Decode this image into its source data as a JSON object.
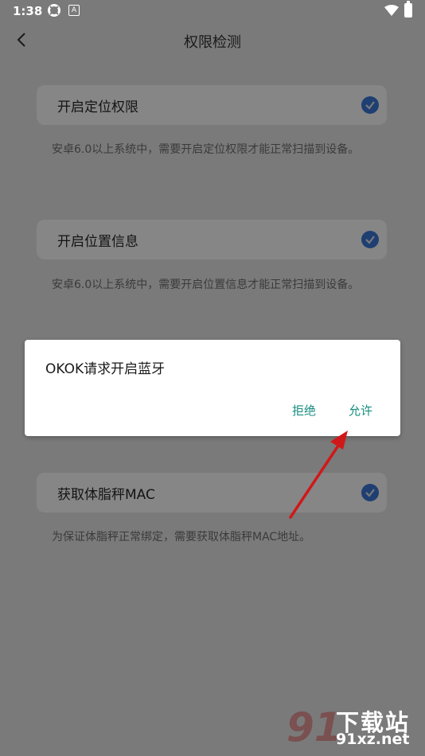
{
  "status_bar": {
    "time": "1:38",
    "icons": [
      "sync-icon",
      "a-notification-icon",
      "wifi-icon",
      "battery-icon"
    ]
  },
  "app_bar": {
    "title": "权限检测"
  },
  "permissions": [
    {
      "label": "开启定位权限",
      "desc": "安卓6.0以上系统中，需要开启定位权限才能正常扫描到设备。",
      "checked": true
    },
    {
      "label": "开启位置信息",
      "desc": "安卓6.0以上系统中，需要开启位置信息才能正常扫描到设备。",
      "checked": true
    },
    {
      "label": "获取体脂秤MAC",
      "desc": "为保证体脂秤正常绑定，需要获取体脂秤MAC地址。",
      "checked": true
    }
  ],
  "dialog": {
    "title": "OKOK请求开启蓝牙",
    "reject_label": "拒绝",
    "allow_label": "允许"
  },
  "watermark": {
    "site_name": "下载站",
    "url": "91xz.net",
    "logo": "91"
  },
  "colors": {
    "dialog_button": "#188c7f",
    "check_badge": "#1f3f72",
    "arrow": "#d01818"
  }
}
